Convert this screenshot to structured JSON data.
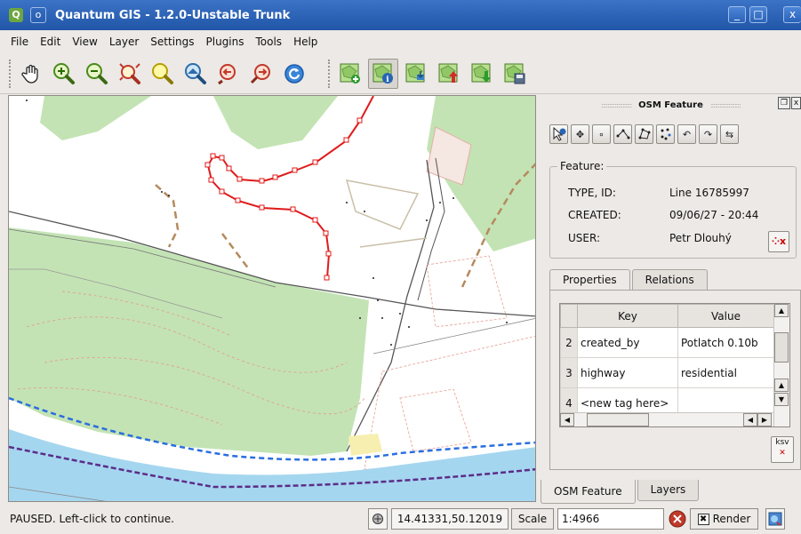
{
  "window": {
    "title": "Quantum GIS - 1.2.0-Unstable Trunk",
    "minimize": "_",
    "maximize": "□",
    "close": "x"
  },
  "menu": [
    "File",
    "Edit",
    "View",
    "Layer",
    "Settings",
    "Plugins",
    "Tools",
    "Help"
  ],
  "toolbar": {
    "nav_tools": [
      "pan-icon",
      "zoom-in-icon",
      "zoom-out-icon",
      "zoom-full-icon",
      "zoom-selection-icon",
      "zoom-layer-icon",
      "zoom-last-icon",
      "zoom-next-icon",
      "refresh-icon"
    ],
    "osm_tools": [
      "osm-load-icon",
      "osm-feature-info-icon",
      "osm-import-icon",
      "osm-upload-icon",
      "osm-download-icon",
      "osm-save-icon"
    ]
  },
  "panel": {
    "title": "OSM Feature",
    "feature_group_label": "Feature:",
    "feature": [
      {
        "label": "TYPE, ID:",
        "value": "Line  16785997"
      },
      {
        "label": "CREATED:",
        "value": "09/06/27 - 20:44"
      },
      {
        "label": "USER:",
        "value": "Petr Dlouhý"
      }
    ],
    "tabs": [
      "Properties",
      "Relations"
    ],
    "table": {
      "headers": [
        "Key",
        "Value"
      ],
      "rows": [
        {
          "n": "2",
          "key": "created_by",
          "value": "Potlatch 0.10b"
        },
        {
          "n": "3",
          "key": "highway",
          "value": "residential"
        },
        {
          "n": "4",
          "key": "<new tag here>",
          "value": ""
        }
      ]
    },
    "bottom_tabs": [
      "OSM Feature",
      "Layers"
    ]
  },
  "status": {
    "message": "PAUSED. Left-click to continue.",
    "coordinates": "14.41331,50.12019",
    "scale_label": "Scale",
    "scale_value": "1:4966",
    "render_label": "Render"
  },
  "colors": {
    "title_bar": "#2a62b8",
    "route": "#e01a1a",
    "forest": "#c3e3b4",
    "water": "#a5d6ef",
    "river_line": "#2a6ee0",
    "boundary": "#5b2d8a"
  }
}
